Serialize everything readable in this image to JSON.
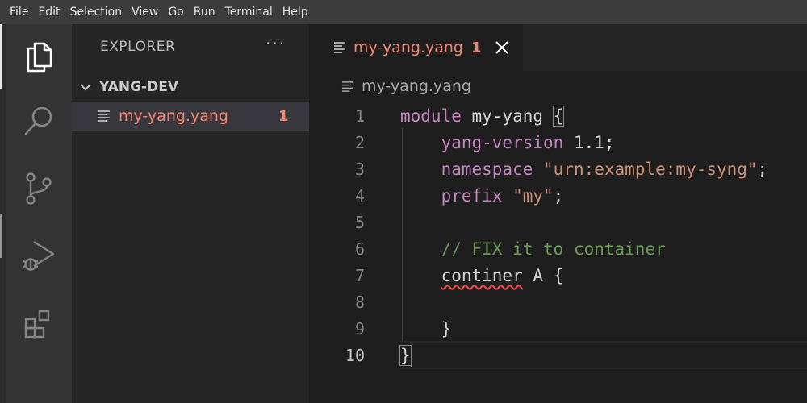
{
  "menu": [
    "File",
    "Edit",
    "Selection",
    "View",
    "Go",
    "Run",
    "Terminal",
    "Help"
  ],
  "activity_bar": [
    "explorer-icon",
    "search-icon",
    "source-control-icon",
    "run-debug-icon",
    "extensions-icon"
  ],
  "sidebar": {
    "title": "EXPLORER",
    "more": "···",
    "folder": "YANG-DEV",
    "file": {
      "name": "my-yang.yang",
      "badge": "1"
    }
  },
  "tab": {
    "name": "my-yang.yang",
    "badge": "1"
  },
  "breadcrumb": "my-yang.yang",
  "editor": {
    "line_numbers": [
      "1",
      "2",
      "3",
      "4",
      "5",
      "6",
      "7",
      "8",
      "9",
      "10"
    ],
    "lines": {
      "l1_kw": "module",
      "l1_rest": " my-yang ",
      "l1_brace": "{",
      "l2_kw": "yang-version",
      "l2_rest": " 1.1;",
      "l3_kw": "namespace",
      "l3_sp": " ",
      "l3_str": "\"urn:example:my-syng\"",
      "l3_end": ";",
      "l4_kw": "prefix",
      "l4_sp": " ",
      "l4_str": "\"my\"",
      "l4_end": ";",
      "l6_comment": "// FIX it to container",
      "l7_err": "continer",
      "l7_rest": " A {",
      "l9": "}",
      "l10": "}"
    }
  },
  "colors": {
    "keyword": "#c586c0",
    "string": "#ce9178",
    "comment": "#6a9955",
    "error_file": "#f48771"
  }
}
